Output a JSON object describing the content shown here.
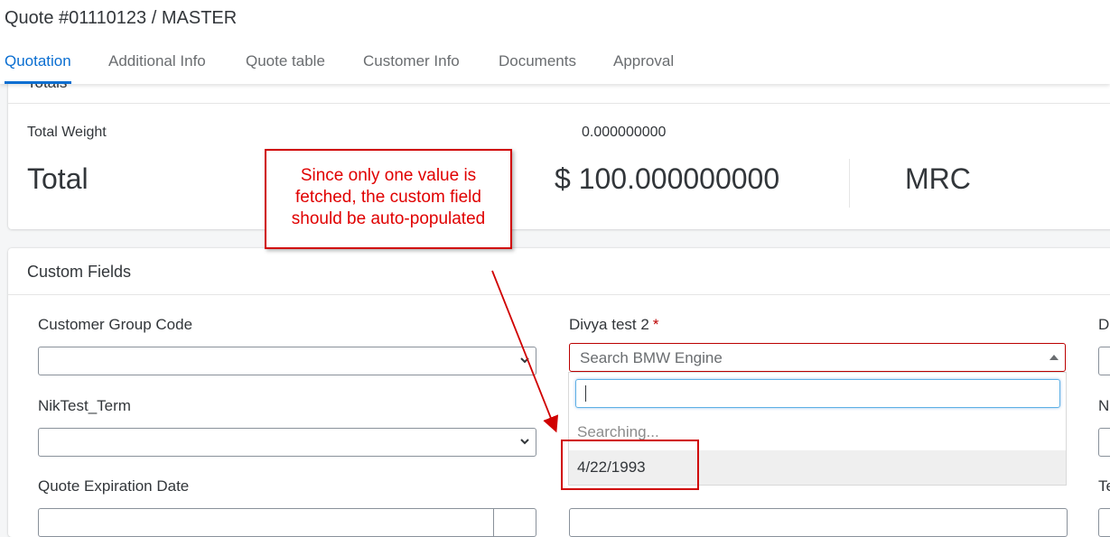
{
  "header": {
    "title": "Quote #01110123 / MASTER",
    "tabs": [
      {
        "label": "Quotation",
        "active": true
      },
      {
        "label": "Additional Info"
      },
      {
        "label": "Quote table"
      },
      {
        "label": "Customer Info"
      },
      {
        "label": "Documents"
      },
      {
        "label": "Approval"
      }
    ]
  },
  "totals": {
    "heading": "Totals",
    "weight_label": "Total Weight",
    "weight_value": "0.000000000",
    "total_label": "Total",
    "total_value": "$ 100.000000000",
    "currency_type": "MRC"
  },
  "custom_fields": {
    "heading": "Custom Fields",
    "customer_group_code_label": "Customer Group Code",
    "niktest_term_label": "NikTest_Term",
    "quote_expiration_label": "Quote Expiration Date",
    "divya_label": "Divya test 2",
    "required_mark": "*",
    "bmw_placeholder": "Search BMW Engine",
    "dropdown_searching": "Searching...",
    "dropdown_option": "4/22/1993",
    "right_col_initials": [
      "D",
      "N",
      "Te"
    ]
  },
  "annotation": {
    "text": "Since only one value is fetched, the custom field should be auto-populated"
  },
  "colors": {
    "accent": "#0a6ed1",
    "annotation": "#e00000",
    "error_border": "#bb0000"
  }
}
